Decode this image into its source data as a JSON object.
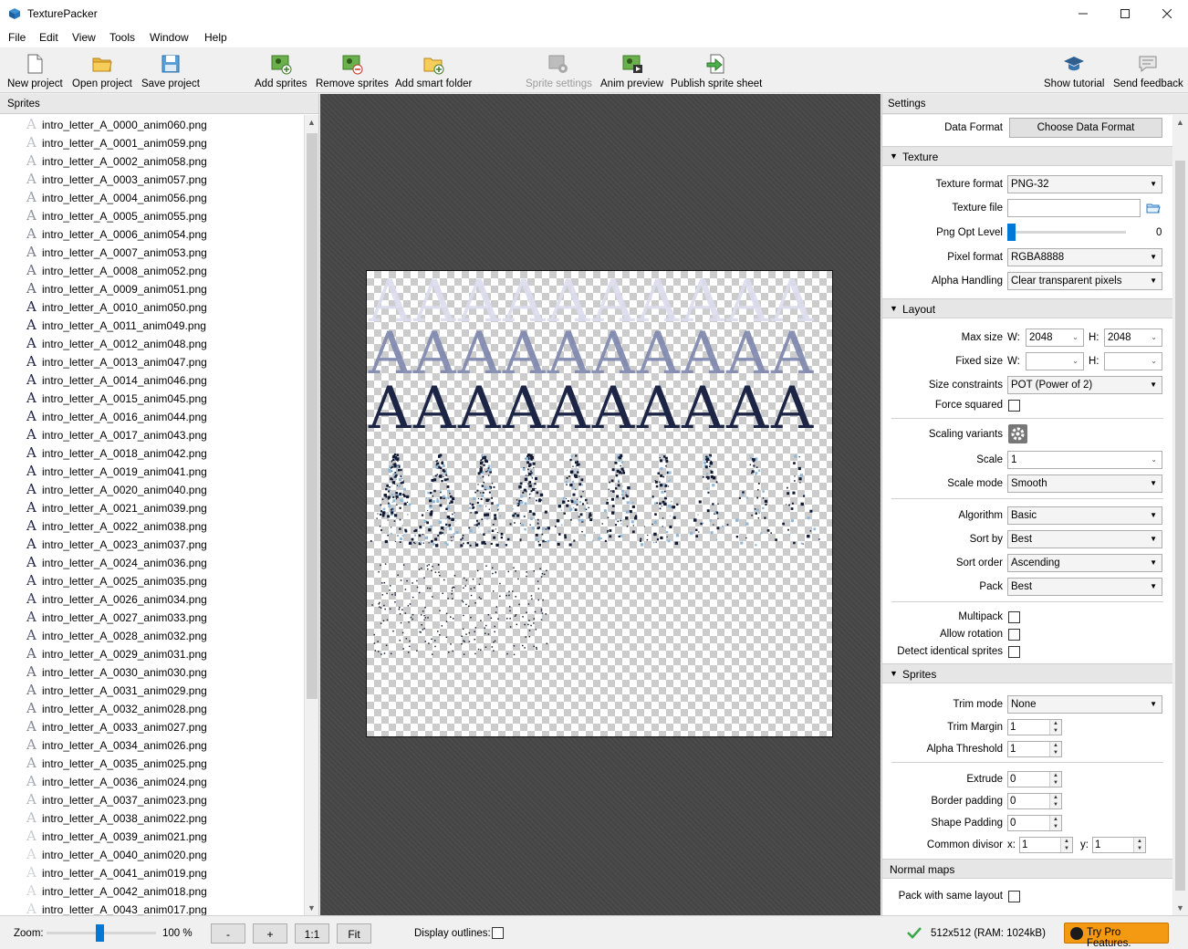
{
  "window": {
    "title": "TexturePacker"
  },
  "menu": [
    "File",
    "Edit",
    "View",
    "Tools",
    "Window",
    "Help"
  ],
  "toolbar": {
    "new_project": "New project",
    "open_project": "Open project",
    "save_project": "Save project",
    "add_sprites": "Add sprites",
    "remove_sprites": "Remove sprites",
    "add_smart_folder": "Add smart folder",
    "sprite_settings": "Sprite settings",
    "anim_preview": "Anim preview",
    "publish_sprite_sheet": "Publish sprite sheet",
    "show_tutorial": "Show tutorial",
    "send_feedback": "Send feedback"
  },
  "sprites_panel": {
    "title": "Sprites",
    "items": [
      "intro_letter_A_0000_anim060.png",
      "intro_letter_A_0001_anim059.png",
      "intro_letter_A_0002_anim058.png",
      "intro_letter_A_0003_anim057.png",
      "intro_letter_A_0004_anim056.png",
      "intro_letter_A_0005_anim055.png",
      "intro_letter_A_0006_anim054.png",
      "intro_letter_A_0007_anim053.png",
      "intro_letter_A_0008_anim052.png",
      "intro_letter_A_0009_anim051.png",
      "intro_letter_A_0010_anim050.png",
      "intro_letter_A_0011_anim049.png",
      "intro_letter_A_0012_anim048.png",
      "intro_letter_A_0013_anim047.png",
      "intro_letter_A_0014_anim046.png",
      "intro_letter_A_0015_anim045.png",
      "intro_letter_A_0016_anim044.png",
      "intro_letter_A_0017_anim043.png",
      "intro_letter_A_0018_anim042.png",
      "intro_letter_A_0019_anim041.png",
      "intro_letter_A_0020_anim040.png",
      "intro_letter_A_0021_anim039.png",
      "intro_letter_A_0022_anim038.png",
      "intro_letter_A_0023_anim037.png",
      "intro_letter_A_0024_anim036.png",
      "intro_letter_A_0025_anim035.png",
      "intro_letter_A_0026_anim034.png",
      "intro_letter_A_0027_anim033.png",
      "intro_letter_A_0028_anim032.png",
      "intro_letter_A_0029_anim031.png",
      "intro_letter_A_0030_anim030.png",
      "intro_letter_A_0031_anim029.png",
      "intro_letter_A_0032_anim028.png",
      "intro_letter_A_0033_anim027.png",
      "intro_letter_A_0034_anim026.png",
      "intro_letter_A_0035_anim025.png",
      "intro_letter_A_0036_anim024.png",
      "intro_letter_A_0037_anim023.png",
      "intro_letter_A_0038_anim022.png",
      "intro_letter_A_0039_anim021.png",
      "intro_letter_A_0040_anim020.png",
      "intro_letter_A_0041_anim019.png",
      "intro_letter_A_0042_anim018.png",
      "intro_letter_A_0043_anim017.png"
    ],
    "thumb_glyph": "A"
  },
  "settings": {
    "title": "Settings",
    "data_format_label": "Data Format",
    "data_format_button": "Choose Data Format",
    "texture": {
      "section": "Texture",
      "texture_format_label": "Texture format",
      "texture_format": "PNG-32",
      "texture_file_label": "Texture file",
      "texture_file": "",
      "png_opt_label": "Png Opt Level",
      "png_opt_value": "0",
      "pixel_format_label": "Pixel format",
      "pixel_format": "RGBA8888",
      "alpha_handling_label": "Alpha Handling",
      "alpha_handling": "Clear transparent pixels"
    },
    "layout": {
      "section": "Layout",
      "max_size_label": "Max size",
      "w_label": "W:",
      "h_label": "H:",
      "max_w": "2048",
      "max_h": "2048",
      "fixed_size_label": "Fixed size",
      "fixed_w": "",
      "fixed_h": "",
      "size_constraints_label": "Size constraints",
      "size_constraints": "POT (Power of 2)",
      "force_squared_label": "Force squared",
      "scaling_variants_label": "Scaling variants",
      "scale_label": "Scale",
      "scale": "1",
      "scale_mode_label": "Scale mode",
      "scale_mode": "Smooth",
      "algorithm_label": "Algorithm",
      "algorithm": "Basic",
      "sort_by_label": "Sort by",
      "sort_by": "Best",
      "sort_order_label": "Sort order",
      "sort_order": "Ascending",
      "pack_label": "Pack",
      "pack": "Best",
      "multipack_label": "Multipack",
      "allow_rotation_label": "Allow rotation",
      "detect_identical_label": "Detect identical sprites"
    },
    "sprites": {
      "section": "Sprites",
      "trim_mode_label": "Trim mode",
      "trim_mode": "None",
      "trim_margin_label": "Trim Margin",
      "trim_margin": "1",
      "alpha_threshold_label": "Alpha Threshold",
      "alpha_threshold": "1",
      "extrude_label": "Extrude",
      "extrude": "0",
      "border_padding_label": "Border padding",
      "border_padding": "0",
      "shape_padding_label": "Shape Padding",
      "shape_padding": "0",
      "common_divisor_label": "Common divisor",
      "x_label": "x:",
      "y_label": "y:",
      "divisor_x": "1",
      "divisor_y": "1"
    },
    "normal_maps": {
      "section": "Normal maps",
      "pack_same_layout_label": "Pack with same layout"
    }
  },
  "statusbar": {
    "zoom_label": "Zoom:",
    "zoom_value": "100 %",
    "zoom_slider_fraction": 0.48,
    "zoom_out": "-",
    "zoom_in": "+",
    "one_to_one": "1:1",
    "fit": "Fit",
    "display_outlines_label": "Display outlines:",
    "sheet_info": "512x512 (RAM: 1024kB)",
    "pro_button": "Try Pro Features."
  },
  "colors": {
    "accent": "#0078d7",
    "pro": "#f39a12",
    "ok_check": "#3aa84a",
    "canvas_bg": "#474747"
  }
}
